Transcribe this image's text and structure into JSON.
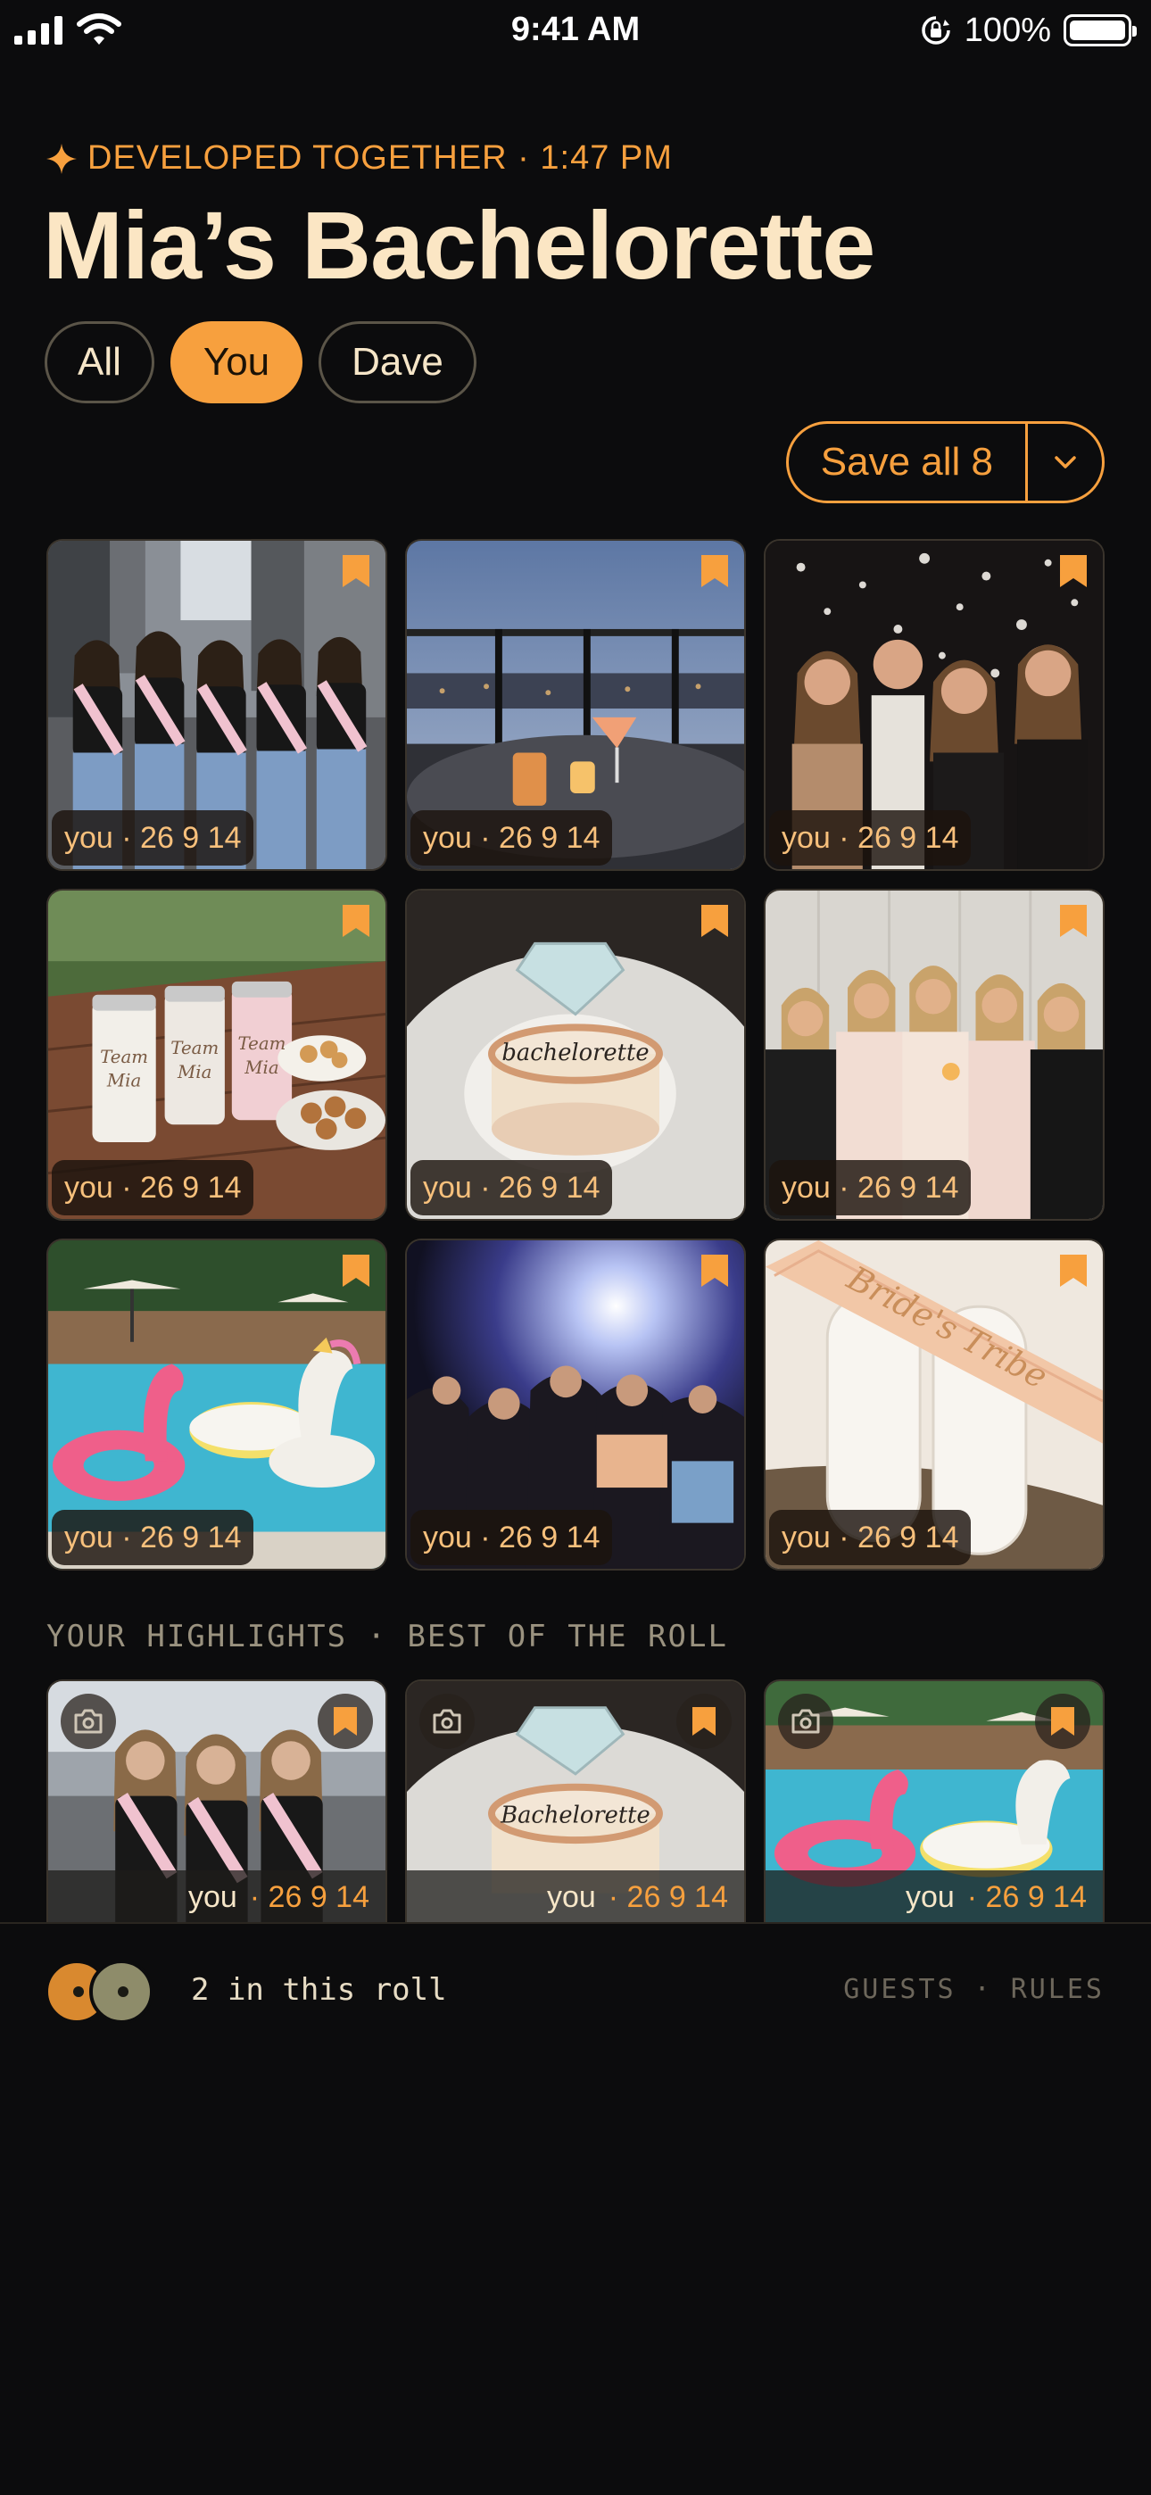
{
  "status_bar": {
    "time": "9:41 AM",
    "battery": "100%"
  },
  "header": {
    "eyebrow": "DEVELOPED TOGETHER · 1:47 PM",
    "title": "Mia’s Bachelorette"
  },
  "filters": [
    {
      "label": "All",
      "active": false
    },
    {
      "label": "You",
      "active": true
    },
    {
      "label": "Dave",
      "active": false
    }
  ],
  "save_button": {
    "label": "Save all 8"
  },
  "photos": [
    {
      "caption": "you · 26 9 14",
      "icon": "bookmark-icon"
    },
    {
      "caption": "you · 26 9 14",
      "icon": "bookmark-icon"
    },
    {
      "caption": "you · 26 9 14",
      "icon": "bookmark-icon"
    },
    {
      "caption": "you · 26 9 14",
      "icon": "bookmark-icon",
      "text": "Team Mia"
    },
    {
      "caption": "you · 26 9 14",
      "icon": "bookmark-icon",
      "text": "bachelorette"
    },
    {
      "caption": "you · 26 9 14",
      "icon": "bookmark-icon"
    },
    {
      "caption": "you · 26 9 14",
      "icon": "bookmark-icon"
    },
    {
      "caption": "you · 26 9 14",
      "icon": "bookmark-icon"
    },
    {
      "caption": "you · 26 9 14",
      "icon": "bookmark-icon",
      "text": "Bride's Tribe"
    }
  ],
  "highlights": {
    "title": "YOUR HIGHLIGHTS · BEST OF THE ROLL",
    "items": [
      {
        "who": "you",
        "meta": "· 26 9 14"
      },
      {
        "who": "you",
        "meta": "· 26 9 14",
        "text": "Bachelorette"
      },
      {
        "who": "you",
        "meta": "· 26 9 14"
      }
    ]
  },
  "footer": {
    "roll_count": "2 in this roll",
    "links": [
      "GUESTS",
      "·",
      "RULES"
    ]
  },
  "colors": {
    "accent": "#f7a03e",
    "background": "#0c0c0d",
    "title": "#fbe6c4"
  }
}
